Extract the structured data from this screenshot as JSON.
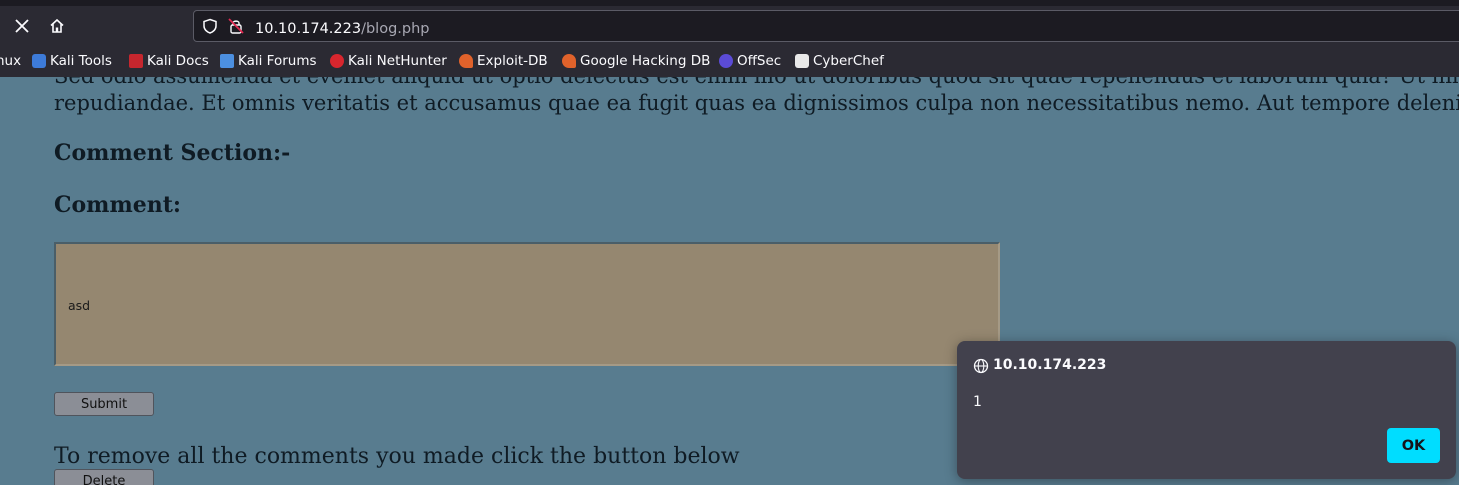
{
  "browser": {
    "url_host": "10.10.174.223",
    "url_path": "/blog.php",
    "bookmarks": [
      {
        "label": "nux",
        "icon": "kali-linux-icon"
      },
      {
        "label": "Kali Tools",
        "icon": "kali-tools-icon"
      },
      {
        "label": "Kali Docs",
        "icon": "kali-docs-icon"
      },
      {
        "label": "Kali Forums",
        "icon": "kali-forums-icon"
      },
      {
        "label": "Kali NetHunter",
        "icon": "kali-nethunter-icon"
      },
      {
        "label": "Exploit-DB",
        "icon": "exploit-db-icon"
      },
      {
        "label": "Google Hacking DB",
        "icon": "google-hacking-db-icon"
      },
      {
        "label": "OffSec",
        "icon": "offsec-icon"
      },
      {
        "label": "CyberChef",
        "icon": "cyberchef-icon"
      }
    ]
  },
  "page": {
    "lorem_line1": "Sed odio assumenda et eveniet aliquid ut optio delectus est enim illo ut doloribus quod sit quae repellendus et laborum quia? Ut nihil itaque nor",
    "lorem_line2": "repudiandae. Et omnis veritatis et accusamus quae ea fugit quas ea dignissimos culpa non necessitatibus nemo. Aut tempore deleniti et quia praese",
    "comment_section_heading": "Comment Section:-",
    "comment_label": "Comment:",
    "comment_value": "asd",
    "submit_label": "Submit",
    "remove_text": "To remove all the comments you made click the button below",
    "delete_label": "Delete"
  },
  "dialog": {
    "origin": "10.10.174.223",
    "message": "1",
    "ok_label": "OK"
  },
  "colors": {
    "page_bg": "#587c8f",
    "textarea_bg": "#958770",
    "ok_button": "#00ddff"
  }
}
